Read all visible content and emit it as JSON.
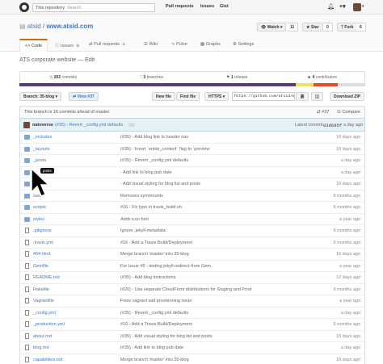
{
  "topbar": {
    "scope": "This repository",
    "search_placeholder": "Search",
    "nav": [
      "Pull requests",
      "Issues",
      "Gist"
    ],
    "icons": [
      "bell-icon",
      "plus-icon",
      "avatar"
    ]
  },
  "repo": {
    "owner": "atsid",
    "name": "www.atsid.com",
    "watch_label": "Watch",
    "watch_count": "11",
    "star_label": "Star",
    "star_count": "0",
    "fork_label": "Fork",
    "fork_count": "6"
  },
  "tabs": [
    {
      "label": "Code",
      "count": ""
    },
    {
      "label": "Issues",
      "count": "9"
    },
    {
      "label": "Pull requests",
      "count": "1"
    },
    {
      "label": "Wiki",
      "count": ""
    },
    {
      "label": "Pulse",
      "count": ""
    },
    {
      "label": "Graphs",
      "count": ""
    },
    {
      "label": "Settings",
      "count": ""
    }
  ],
  "description": "ATS corporate website — Edit",
  "summary": {
    "commits_num": "202",
    "commits_label": "commits",
    "branches_num": "3",
    "branches_label": "branches",
    "releases_num": "1",
    "releases_label": "release",
    "contributors_num": "4",
    "contributors_label": "contributors"
  },
  "language_colors": [
    "#563d7c",
    "#f1e05a",
    "#e34c26",
    "#dddddd"
  ],
  "controls": {
    "branch_label": "Branch: 35-blog",
    "view_label": "View #37",
    "new_file": "New file",
    "find_file": "Find file",
    "https_label": "HTTPS",
    "clone_url": "https://github.com/atsid/w",
    "download": "Download ZIP"
  },
  "ahead": {
    "text": "This branch is 16 commits ahead of master.",
    "pr": "#37",
    "compare": "Compare"
  },
  "last_commit": {
    "author": "natoverse",
    "message": "(#35) - Revert _config.yml defaults",
    "latest_label": "Latest commit",
    "sha": "83d685f",
    "age": "a day ago"
  },
  "files": [
    {
      "type": "dir",
      "name": "_includes",
      "msg": "(#35) - Add blog link to header nav",
      "age": "16 days ago"
    },
    {
      "type": "dir",
      "name": "_layouts",
      "msg": "(#35) - Invert `entire_content` flag to `preview`",
      "age": "16 days ago"
    },
    {
      "type": "dir",
      "name": "_posts",
      "msg": "(#35) - Revert _config.yml defaults",
      "age": "a day ago"
    },
    {
      "type": "dir",
      "name": "",
      "msg": "- Add link to blog pub date",
      "age": "a day ago"
    },
    {
      "type": "dir",
      "name": "",
      "msg": "- Add visual styling for blog list and posts",
      "age": "16 days ago"
    },
    {
      "type": "dir",
      "name": "sass",
      "msg": "Removes symmounts",
      "age": "6 months ago"
    },
    {
      "type": "dir",
      "name": "scripts",
      "msg": "#16 - Fix typo in travis_build.sh",
      "age": "6 months ago"
    },
    {
      "type": "dir",
      "name": "styles",
      "msg": "Adds icon font",
      "age": "a year ago"
    },
    {
      "type": "file",
      "name": ".gitignore",
      "msg": "Ignore .jekyll-metadata",
      "age": "6 months ago"
    },
    {
      "type": "file",
      "name": ".travis.yml",
      "msg": "#16 - Add a Travis Build/Deployment",
      "age": "6 months ago"
    },
    {
      "type": "file",
      "name": "404.html",
      "msg": "Merge branch 'master' into 35-blog",
      "age": "16 days ago"
    },
    {
      "type": "file",
      "name": "Gemfile",
      "msg": "For Issue #5 - testing jekyll-redirect-from Gem",
      "age": "a year ago"
    },
    {
      "type": "file",
      "name": "README.md",
      "msg": "(#35) - Add blog instructions",
      "age": "12 days ago"
    },
    {
      "type": "file",
      "name": "Rakefile",
      "msg": "(#20) - Use separate CloudFront distributions for Staging and Prod",
      "age": "6 months ago"
    },
    {
      "type": "file",
      "name": "Vagrantfile",
      "msg": "Fixes vagrant salt provisioning issue",
      "age": "a year ago"
    },
    {
      "type": "file",
      "name": "_config.yml",
      "msg": "(#35) - Revert _config.yml defaults",
      "age": "a day ago"
    },
    {
      "type": "file",
      "name": "_production.yml",
      "msg": "#16 - Add a Travis Build/Deployment",
      "age": "6 months ago"
    },
    {
      "type": "file",
      "name": "about.md",
      "msg": "(#35) - Add visual styling for blog list and posts",
      "age": "16 days ago"
    },
    {
      "type": "file",
      "name": "blog.md",
      "msg": "(#35) - Add link to blog pub date",
      "age": "a day ago"
    },
    {
      "type": "file",
      "name": "capabilities.md",
      "msg": "Merge branch 'master' into 35-blog",
      "age": "16 days ago"
    }
  ],
  "tooltip": "posts"
}
